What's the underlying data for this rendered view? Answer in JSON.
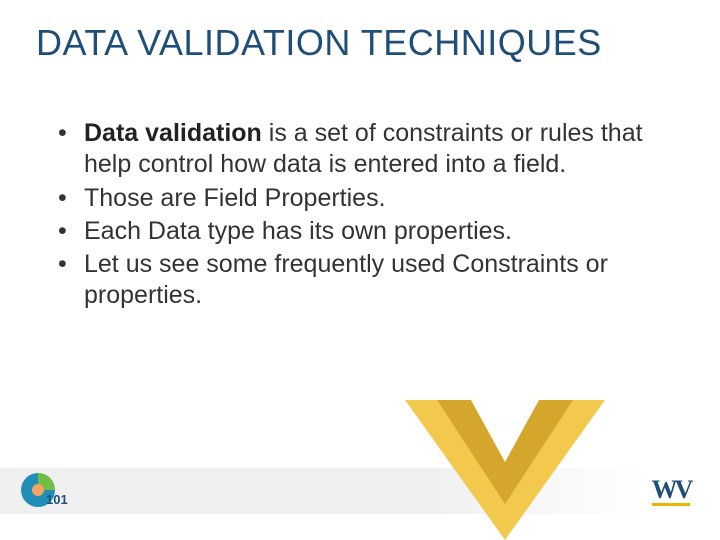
{
  "title": "DATA VALIDATION TECHNIQUES",
  "bullets": [
    {
      "bold": "Data validation",
      "rest": " is a set of constraints or rules that help control how data is entered into a field."
    },
    {
      "bold": "",
      "rest": "Those are Field Properties."
    },
    {
      "bold": "",
      "rest": "Each Data type has its own properties."
    },
    {
      "bold": "",
      "rest": "Let us see some frequently used Constraints or properties."
    }
  ],
  "footer": {
    "left_logo_label": "101",
    "wv_label": "WV"
  },
  "colors": {
    "heading": "#1f4e79",
    "chevron_outer": "#f2c94c",
    "chevron_inner": "#d4a72c"
  }
}
